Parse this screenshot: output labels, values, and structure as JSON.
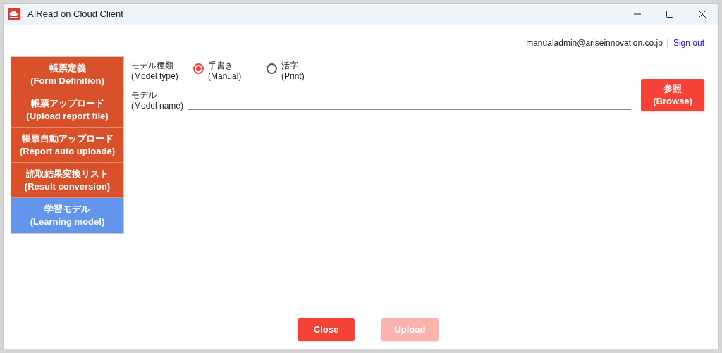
{
  "window": {
    "title": "AIRead on Cloud Client"
  },
  "account": {
    "email": "manualadmin@ariseinnovation.co.jp",
    "separator": "|",
    "sign_out": "Sign out"
  },
  "nav": [
    {
      "label": "帳票定義",
      "sublabel": "(Form Definition)",
      "selected": false
    },
    {
      "label": "帳票アップロード",
      "sublabel": "(Upload report file)",
      "selected": false
    },
    {
      "label": "帳票自動アップロード",
      "sublabel": "(Report auto uploade)",
      "selected": false
    },
    {
      "label": "読取結果変換リスト",
      "sublabel": "(Result conversion)",
      "selected": false
    },
    {
      "label": "学習モデル",
      "sublabel": "(Learning model)",
      "selected": true
    }
  ],
  "model_type": {
    "label": "モデル種類",
    "sublabel": "(Model type)",
    "options": [
      {
        "label": "手書き",
        "sublabel": "(Manual)",
        "selected": true
      },
      {
        "label": "活字",
        "sublabel": "(Print)",
        "selected": false
      }
    ]
  },
  "model_name": {
    "label": "モデル",
    "sublabel": "(Model name)",
    "browse": {
      "label": "参照",
      "sublabel": "(Browse)"
    }
  },
  "buttons": [
    {
      "label": "Close",
      "disabled": false
    },
    {
      "label": "Upload",
      "disabled": true
    }
  ]
}
